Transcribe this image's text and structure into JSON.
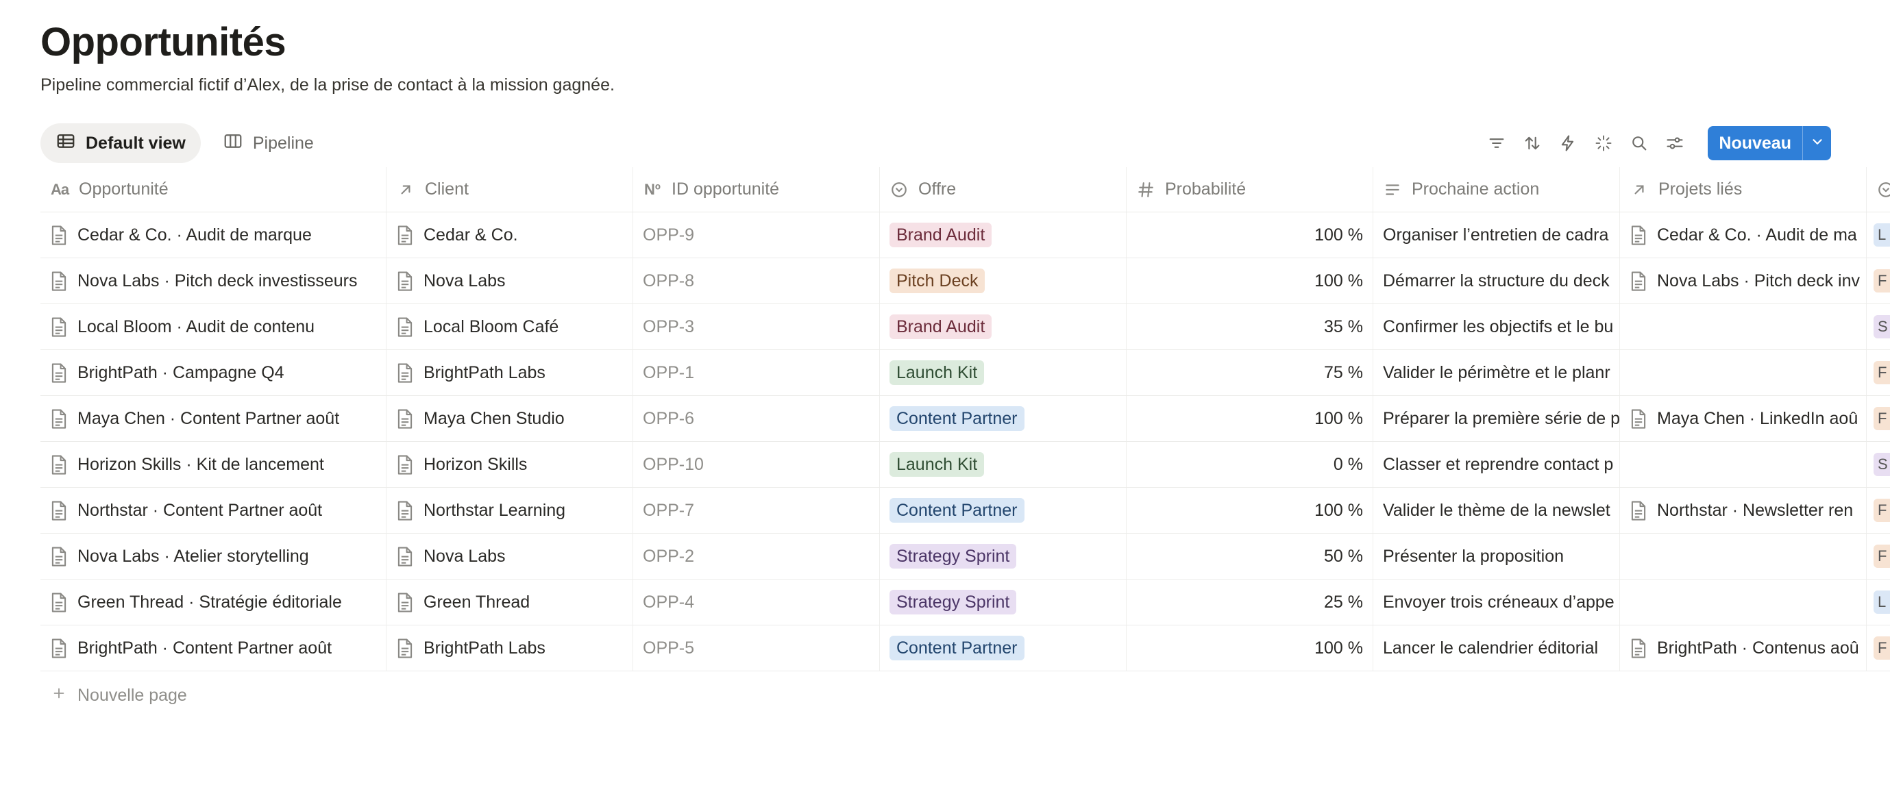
{
  "page": {
    "title": "Opportunités",
    "description": "Pipeline commercial fictif d’Alex, de la prise de contact à la mission gagnée."
  },
  "views": [
    {
      "label": "Default view",
      "icon": "table-icon",
      "active": true
    },
    {
      "label": "Pipeline",
      "icon": "board-icon",
      "active": false
    }
  ],
  "toolbar": {
    "icons": [
      "filter-icon",
      "sort-icon",
      "automation-icon",
      "ai-sparkle-icon",
      "search-icon",
      "settings-icon"
    ],
    "new_label": "Nouveau"
  },
  "columns": [
    {
      "label": "Opportunité",
      "icon": "title-icon"
    },
    {
      "label": "Client",
      "icon": "relation-icon"
    },
    {
      "label": "ID opportunité",
      "icon": "id-icon"
    },
    {
      "label": "Offre",
      "icon": "select-icon"
    },
    {
      "label": "Probabilité",
      "icon": "number-icon"
    },
    {
      "label": "Prochaine action",
      "icon": "text-icon"
    },
    {
      "label": "Projets liés",
      "icon": "relation-icon"
    },
    {
      "label": "",
      "icon": "status-icon"
    }
  ],
  "rows": [
    {
      "name": "Cedar & Co. · Audit de marque",
      "client": "Cedar & Co.",
      "id": "OPP-9",
      "offer": "Brand Audit",
      "prob": "100 %",
      "action": "Organiser l’entretien de cadra",
      "project": "Cedar & Co. · Audit de ma",
      "edge": "L"
    },
    {
      "name": "Nova Labs · Pitch deck investisseurs",
      "client": "Nova Labs",
      "id": "OPP-8",
      "offer": "Pitch Deck",
      "prob": "100 %",
      "action": "Démarrer la structure du deck",
      "project": "Nova Labs · Pitch deck inv",
      "edge": "F"
    },
    {
      "name": "Local Bloom · Audit de contenu",
      "client": "Local Bloom Café",
      "id": "OPP-3",
      "offer": "Brand Audit",
      "prob": "35 %",
      "action": "Confirmer les objectifs et le bu",
      "project": "",
      "edge": "S"
    },
    {
      "name": "BrightPath · Campagne Q4",
      "client": "BrightPath Labs",
      "id": "OPP-1",
      "offer": "Launch Kit",
      "prob": "75 %",
      "action": "Valider le périmètre et le planr",
      "project": "",
      "edge": "F"
    },
    {
      "name": "Maya Chen · Content Partner août",
      "client": "Maya Chen Studio",
      "id": "OPP-6",
      "offer": "Content Partner",
      "prob": "100 %",
      "action": "Préparer la première série de p",
      "project": "Maya Chen · LinkedIn aoû",
      "edge": "F"
    },
    {
      "name": "Horizon Skills · Kit de lancement",
      "client": "Horizon Skills",
      "id": "OPP-10",
      "offer": "Launch Kit",
      "prob": "0 %",
      "action": "Classer et reprendre contact p",
      "project": "",
      "edge": "S"
    },
    {
      "name": "Northstar · Content Partner août",
      "client": "Northstar Learning",
      "id": "OPP-7",
      "offer": "Content Partner",
      "prob": "100 %",
      "action": "Valider le thème de la newslet",
      "project": "Northstar · Newsletter ren",
      "edge": "F"
    },
    {
      "name": "Nova Labs · Atelier storytelling",
      "client": "Nova Labs",
      "id": "OPP-2",
      "offer": "Strategy Sprint",
      "prob": "50 %",
      "action": "Présenter la proposition",
      "project": "",
      "edge": "F"
    },
    {
      "name": "Green Thread · Stratégie éditoriale",
      "client": "Green Thread",
      "id": "OPP-4",
      "offer": "Strategy Sprint",
      "prob": "25 %",
      "action": "Envoyer trois créneaux d’appe",
      "project": "",
      "edge": "L"
    },
    {
      "name": "BrightPath · Content Partner août",
      "client": "BrightPath Labs",
      "id": "OPP-5",
      "offer": "Content Partner",
      "prob": "100 %",
      "action": "Lancer le calendrier éditorial",
      "project": "BrightPath · Contenus aoû",
      "edge": "F"
    }
  ],
  "offer_colors": {
    "Brand Audit": {
      "bg": "#f6e1e6",
      "fg": "#6b2b3a"
    },
    "Pitch Deck": {
      "bg": "#f7e3d3",
      "fg": "#6a3f20"
    },
    "Launch Kit": {
      "bg": "#dcebdd",
      "fg": "#2f4d33"
    },
    "Content Partner": {
      "bg": "#d9e7f6",
      "fg": "#23466e"
    },
    "Strategy Sprint": {
      "bg": "#e8def2",
      "fg": "#4b3566"
    }
  },
  "edge_colors": {
    "L": "#dbe7f6",
    "F": "#f7e3d3",
    "S": "#e8def2"
  },
  "footer": {
    "new_page_label": "Nouvelle page"
  }
}
